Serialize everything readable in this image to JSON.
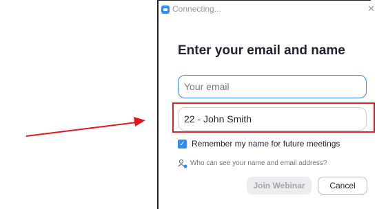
{
  "window": {
    "title": "Connecting..."
  },
  "form": {
    "heading": "Enter your email and name",
    "email_placeholder": "Your email",
    "name_value": "22 - John Smith",
    "remember_label": "Remember my name for future meetings",
    "remember_checked": true,
    "info_link": "Who can see your name and email address?"
  },
  "buttons": {
    "join": "Join Webinar",
    "cancel": "Cancel"
  },
  "colors": {
    "accent": "#2d8cff",
    "highlight": "#d9262c",
    "arrow": "#e8141a"
  },
  "icons": [
    "app-icon",
    "close-icon",
    "check-icon",
    "users-info-icon",
    "arrow-icon"
  ]
}
